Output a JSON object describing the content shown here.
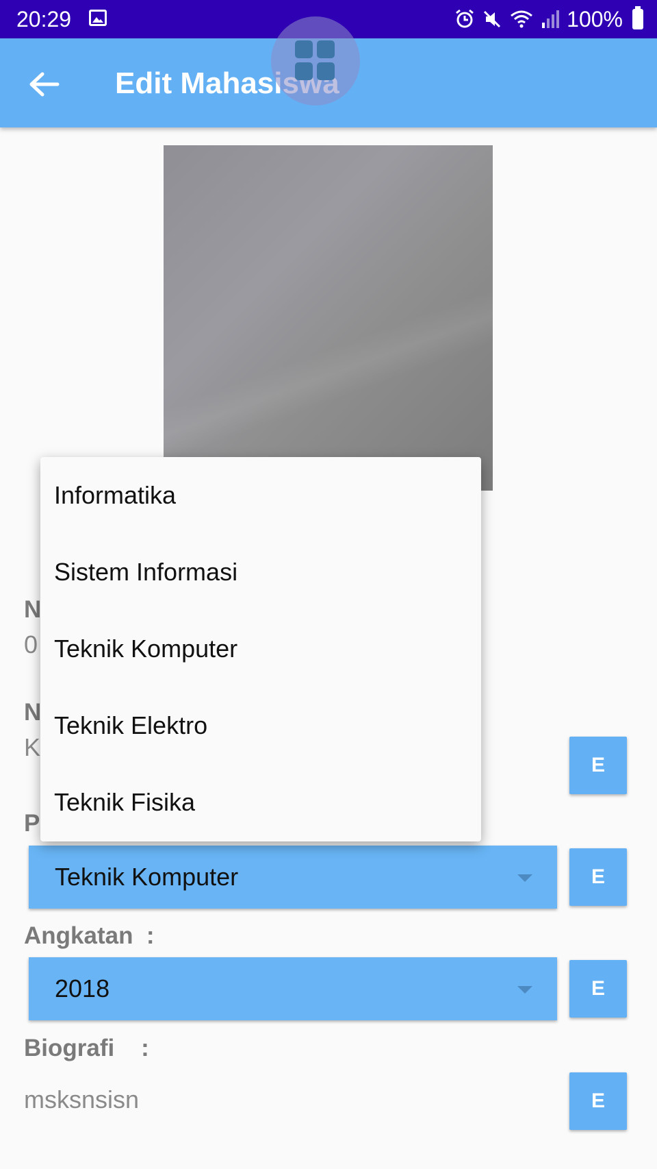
{
  "status_bar": {
    "time": "20:29",
    "battery": "100%",
    "icons": [
      "gallery-icon",
      "alarm-icon",
      "mute-icon",
      "wifi-icon",
      "signal-icon",
      "battery-icon"
    ]
  },
  "app_bar": {
    "title": "Edit Mahasiswa",
    "back_icon": "arrow-left-icon",
    "color": "#64b0f4"
  },
  "form": {
    "nim_label": "N",
    "nim_value": "0",
    "nama_label": "N",
    "nama_value": "K",
    "prodi_label": "P",
    "prodi_value": "Teknik Komputer",
    "angkatan_label": "Angkatan  :",
    "angkatan_value": "2018",
    "biografi_label": "Biografi    :",
    "biografi_value": "msksnsisn",
    "edit_button_label": "E"
  },
  "dropdown": {
    "options": [
      "Informatika",
      "Sistem Informasi",
      "Teknik Komputer",
      "Teknik Elektro",
      "Teknik Fisika"
    ]
  },
  "colors": {
    "status_bar": "#2f00b3",
    "accent": "#64b0f4",
    "spinner": "#68b4f4"
  }
}
